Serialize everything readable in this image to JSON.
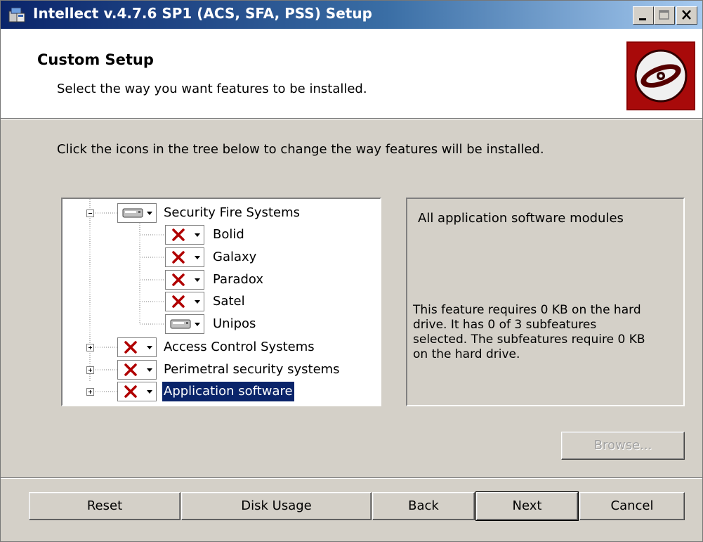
{
  "window": {
    "title": "Intellect v.4.7.6 SP1 (ACS, SFA, PSS) Setup",
    "icon": "setup-icon",
    "controls": [
      "minimize-icon",
      "maximize-icon",
      "close-icon"
    ]
  },
  "header": {
    "title": "Custom Setup",
    "subtitle": "Select the way you want features to be installed.",
    "logo_icon": "cd-disc-icon",
    "logo_color": "#8b0000"
  },
  "instruction": "Click the icons in the tree below to change the way features will be installed.",
  "tree": {
    "nodes": [
      {
        "label": "Security Fire Systems",
        "state": "local-drive",
        "expander": "collapse",
        "selected": false
      },
      {
        "label": "Bolid",
        "state": "unavailable",
        "expander": null,
        "selected": false
      },
      {
        "label": "Galaxy",
        "state": "unavailable",
        "expander": null,
        "selected": false
      },
      {
        "label": "Paradox",
        "state": "unavailable",
        "expander": null,
        "selected": false
      },
      {
        "label": "Satel",
        "state": "unavailable",
        "expander": null,
        "selected": false
      },
      {
        "label": "Unipos",
        "state": "local-drive",
        "expander": null,
        "selected": false
      },
      {
        "label": "Access Control Systems",
        "state": "unavailable",
        "expander": "expand",
        "selected": false
      },
      {
        "label": "Perimetral security systems",
        "state": "unavailable",
        "expander": "expand",
        "selected": false
      },
      {
        "label": "Application software",
        "state": "unavailable",
        "expander": "expand",
        "selected": true
      }
    ]
  },
  "description": {
    "title": "All application software modules",
    "body": "This feature requires 0 KB on the hard drive. It has 0 of 3 subfeatures selected. The subfeatures require 0 KB on the hard drive."
  },
  "buttons": {
    "browse": "Browse...",
    "reset": "Reset",
    "disk_usage": "Disk Usage",
    "back": "Back",
    "next": "Next",
    "cancel": "Cancel"
  },
  "colors": {
    "selection": "#0a246a",
    "x_mark": "#b00000"
  }
}
